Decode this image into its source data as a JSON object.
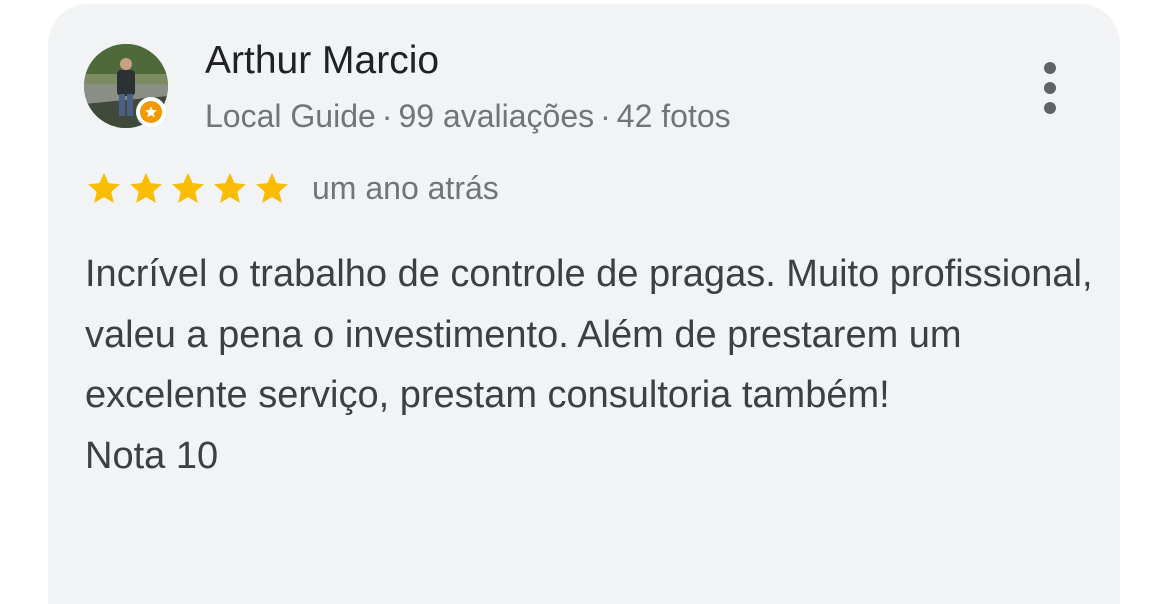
{
  "review": {
    "author": {
      "name": "Arthur Marcio",
      "avatar_icon": "profile-photo",
      "badge_icon": "local-guide-star-icon",
      "level": "Local Guide",
      "reviews_count": "99 avaliações",
      "photos_count": "42 fotos",
      "separator": "·"
    },
    "rating": {
      "stars": 5,
      "max_stars": 5,
      "star_color": "#fbbc04"
    },
    "time": "um ano atrás",
    "text": "Incrível o trabalho de controle de pragas. Muito profissional, valeu a pena o investimento. Além de prestarem um excelente serviço, prestam consultoria também!",
    "note": "Nota 10",
    "menu_icon": "more-vert-icon"
  }
}
